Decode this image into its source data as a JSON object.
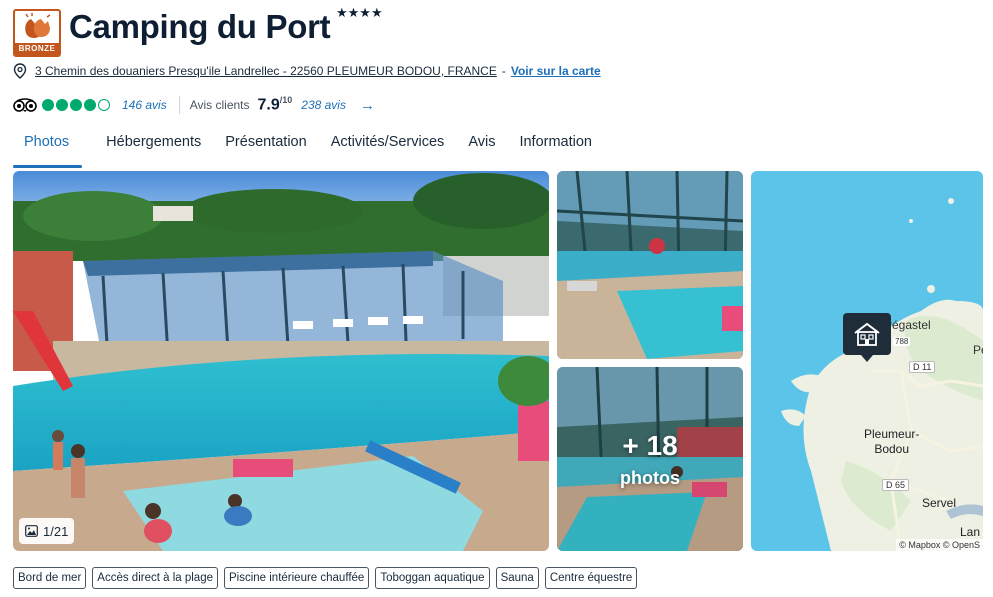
{
  "header": {
    "badge_label": "BRONZE",
    "badge_icon": "clapping-hands-icon",
    "title": "Camping du Port",
    "stars": "★★★★",
    "address": "3 Chemin des douaniers Presqu'ile Landrellec - 22560 PLEUMEUR BODOU, FRANCE",
    "address_sep": "-",
    "map_link": "Voir sur la carte"
  },
  "ratings": {
    "tripadvisor_bubbles": 4,
    "tripadvisor_bubbles_max": 5,
    "tripadvisor_reviews": "146 avis",
    "clients_label": "Avis clients",
    "score": "7.9",
    "score_max": "/10",
    "client_reviews": "238 avis",
    "arrow": "→"
  },
  "tabs": [
    {
      "label": "Photos",
      "active": true
    },
    {
      "label": "Hébergements",
      "active": false
    },
    {
      "label": "Présentation",
      "active": false
    },
    {
      "label": "Activités/Services",
      "active": false
    },
    {
      "label": "Avis",
      "active": false
    },
    {
      "label": "Information",
      "active": false
    }
  ],
  "gallery": {
    "counter": "1/21",
    "more_count": "+ 18",
    "more_label": "photos"
  },
  "map": {
    "labels": {
      "tregastel": "régastel",
      "d788": "788",
      "d11": "D 11",
      "pleumeur_line1": "Pleumeur-",
      "pleumeur_line2": "Bodou",
      "d65": "D 65",
      "servel": "Servel",
      "pe": "Pe",
      "lan": "Lan"
    },
    "attribution": "© Mapbox © OpenS",
    "marker_icon": "campsite-house-icon"
  },
  "tags": [
    "Bord de mer",
    "Accès direct à la plage",
    "Piscine intérieure chauffée",
    "Toboggan aquatique",
    "Sauna",
    "Centre équestre"
  ],
  "colors": {
    "accent": "#1d6fb8",
    "bronze": "#c2561d",
    "tripadvisor_green": "#00aa6c",
    "text": "#0e1f33"
  }
}
